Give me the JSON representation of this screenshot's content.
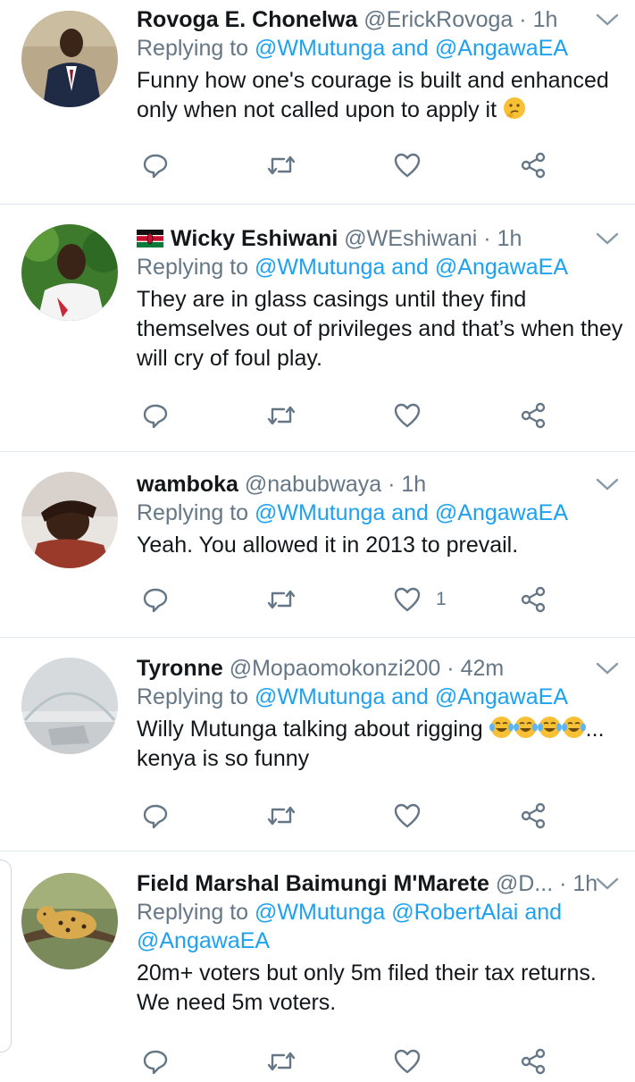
{
  "tweets": [
    {
      "name": "Rovoga E. Chonelwa",
      "handle": "@ErickRovoga",
      "separator": "·",
      "time": "1h",
      "replying_prefix": "Replying to",
      "mentions": [
        "@WMutunga",
        "@AngawaEA"
      ],
      "mention_joiner": "and",
      "text": "Funny how one's courage is built and enhanced only when not called upon to apply it",
      "emoji": "thinking-face",
      "likes": ""
    },
    {
      "flag": "kenya-flag",
      "name": "Wicky Eshiwani",
      "handle": "@WEshiwani",
      "separator": "·",
      "time": "1h",
      "replying_prefix": "Replying to",
      "mentions": [
        "@WMutunga",
        "@AngawaEA"
      ],
      "mention_joiner": "and",
      "text": "They are in glass casings until they find themselves out of privileges and that’s when they will cry of foul play.",
      "likes": ""
    },
    {
      "name": "wamboka",
      "handle": "@nabubwaya",
      "separator": "·",
      "time": "1h",
      "replying_prefix": "Replying to",
      "mentions": [
        "@WMutunga",
        "@AngawaEA"
      ],
      "mention_joiner": "and",
      "text": "Yeah. You allowed it in 2013 to prevail.",
      "likes": "1"
    },
    {
      "name": "Tyronne",
      "handle": "@Mopaomokonzi200",
      "separator": "·",
      "time": "42m",
      "replying_prefix": "Replying to",
      "mentions": [
        "@WMutunga",
        "@AngawaEA"
      ],
      "mention_joiner": "and",
      "text_before": "Willy Mutunga talking about rigging",
      "emoji": "face-with-tears-of-joy",
      "emoji_count": 4,
      "text_after": "... kenya is so funny",
      "likes": ""
    },
    {
      "name": "Field Marshal Baimungi M'Marete",
      "handle": "@D...",
      "separator": "·",
      "time": "1h",
      "replying_prefix": "Replying to",
      "mentions": [
        "@WMutunga",
        "@RobertAlai",
        "@AngawaEA"
      ],
      "mention_joiner": "and",
      "text": "20m+ voters but only 5m filed their tax returns. We need 5m voters.",
      "likes": ""
    }
  ],
  "colors": {
    "mention": "#1da1f2",
    "secondary_text": "#657786",
    "divider": "#e1e8ed",
    "icon": "#657786"
  },
  "icons": [
    "reply-icon",
    "retweet-icon",
    "like-icon",
    "share-icon",
    "chevron-down-icon"
  ]
}
